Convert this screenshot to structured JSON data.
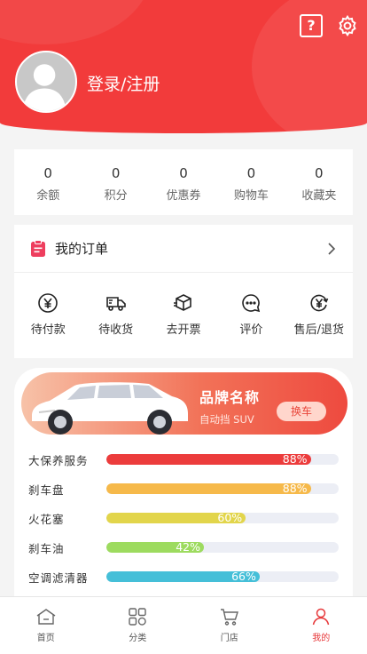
{
  "header": {
    "help_symbol": "?",
    "login_label": "登录/注册",
    "accent_color": "#f23b3b"
  },
  "stats": [
    {
      "value": "0",
      "label": "余额"
    },
    {
      "value": "0",
      "label": "积分"
    },
    {
      "value": "0",
      "label": "优惠券"
    },
    {
      "value": "0",
      "label": "购物车"
    },
    {
      "value": "0",
      "label": "收藏夹"
    }
  ],
  "orders": {
    "title": "我的订单",
    "items": [
      {
        "label": "待付款",
        "icon": "yen-circle-icon"
      },
      {
        "label": "待收货",
        "icon": "truck-icon"
      },
      {
        "label": "去开票",
        "icon": "box-icon"
      },
      {
        "label": "评价",
        "icon": "chat-bubble-icon"
      },
      {
        "label": "售后/退货",
        "icon": "yen-refresh-icon"
      }
    ]
  },
  "car": {
    "brand": "品牌名称",
    "subtitle": "自动挡 SUV",
    "switch_label": "换车"
  },
  "parts": [
    {
      "name": "大保养服务",
      "percent": "88%",
      "level": 0.88,
      "color": "#ec3c3c"
    },
    {
      "name": "刹车盘",
      "percent": "88%",
      "level": 0.88,
      "color": "#f6b94a"
    },
    {
      "name": "火花塞",
      "percent": "60%",
      "level": 0.6,
      "color": "#e2d54b"
    },
    {
      "name": "刹车油",
      "percent": "42%",
      "level": 0.42,
      "color": "#9ddb5f"
    },
    {
      "name": "空调滤清器",
      "percent": "66%",
      "level": 0.66,
      "color": "#45bfd8"
    }
  ],
  "tabbar": [
    {
      "label": "首页",
      "icon": "home-icon"
    },
    {
      "label": "分类",
      "icon": "grid-icon"
    },
    {
      "label": "门店",
      "icon": "cart-icon"
    },
    {
      "label": "我的",
      "icon": "person-icon",
      "active": true
    }
  ]
}
